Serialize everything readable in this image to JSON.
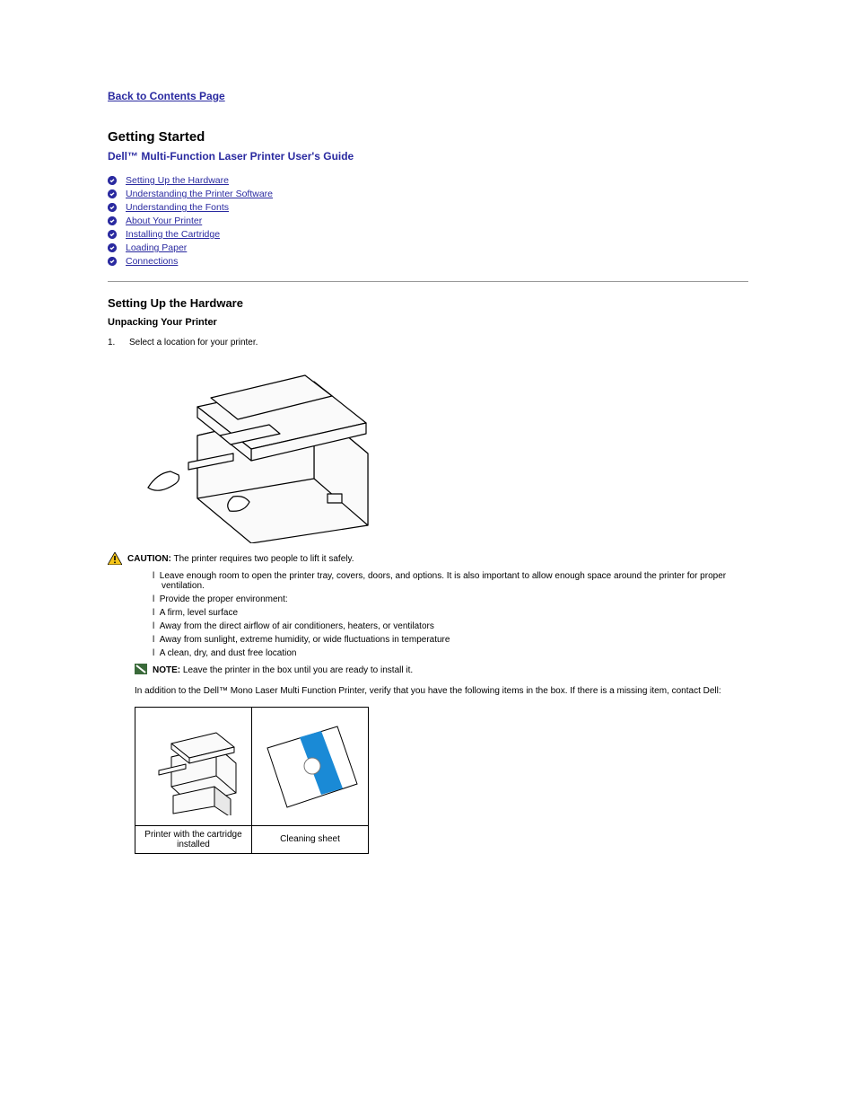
{
  "back": "Back to Contents Page",
  "page_title": "Getting Started",
  "subtitle": "Dell™ Multi-Function Laser Printer User's Guide",
  "toc": [
    "Setting Up the Hardware",
    "Understanding the Printer Software",
    "Understanding the Fonts",
    "About Your Printer",
    "Installing the Cartridge",
    "Loading Paper",
    "Connections"
  ],
  "h_unpack": "Setting Up the Hardware",
  "unpack_sub": "Unpacking Your Printer",
  "step1_num": "1.",
  "step1": "Select a location for your printer.",
  "caution_label": "CAUTION:",
  "caution_text": " The printer requires two people to lift it safely.",
  "bullets": [
    "Leave enough room to open the printer tray, covers, doors, and options. It is also important to allow enough space around the printer for proper ventilation.",
    "Provide the proper environment:",
    "A firm, level surface",
    "Away from the direct airflow of air conditioners, heaters, or ventilators",
    "Away from sunlight, extreme humidity, or wide fluctuations in temperature",
    "A clean, dry, and dust free location"
  ],
  "note_label": "NOTE:",
  "note_text": " Leave the printer in the box until you are ready to install it.",
  "addl_intro": "In addition to the Dell™ Mono Laser Multi Function Printer, verify that you have the following items in the box. If there is a missing item, contact Dell:",
  "parts": {
    "a": "Printer with the cartridge installed",
    "b": "Cleaning sheet"
  }
}
